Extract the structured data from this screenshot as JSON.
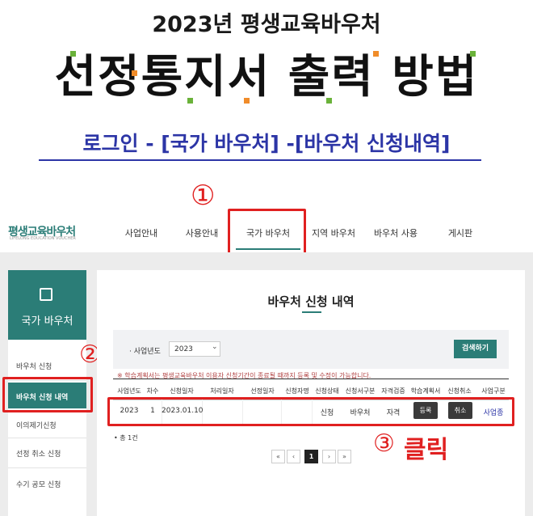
{
  "header": {
    "supertitle": "2023년 평생교육바우처",
    "title": "선정통지서 출력 방법",
    "subtitle": "로그인 - [국가 바우처] -[바우처 신청내역]"
  },
  "annotations": {
    "step1": "①",
    "step2": "②",
    "step3": "③",
    "step3_label": "클릭",
    "color": "#e02020"
  },
  "site": {
    "logo_text": "평생교육바우처",
    "logo_subtext": "LIFELONG EDUCATION VOUCHER"
  },
  "nav": {
    "items": [
      "사업안내",
      "사용안내",
      "국가 바우처",
      "지역 바우처",
      "바우처 사용",
      "게시판"
    ],
    "active": "국가 바우처"
  },
  "sidebar": {
    "title": "국가 바우처",
    "icon": "edit-icon",
    "items": [
      "바우처 신청",
      "바우처 신청 내역",
      "이의제기신청",
      "선정 취소 신청",
      "수기 공모 신청"
    ],
    "active": "바우처 신청 내역"
  },
  "main": {
    "heading": "바우처 신청 내역",
    "filter": {
      "label": "사업년도",
      "value": "2023",
      "search_label": "검색하기"
    },
    "notice": "※ 학습계획서는 평생교육바우처 이용자 신청기간이 종료될 때까지 등록 및 수정이 가능합니다.",
    "table": {
      "columns": [
        "사업년도",
        "차수",
        "신청일자",
        "처리일자",
        "선정일자",
        "신청자명",
        "신청상태",
        "신청서구분",
        "자격검증",
        "학습계획서",
        "신청취소",
        "사업구분"
      ],
      "row": {
        "year": "2023",
        "round": "1",
        "apply_date": "2023.01.10",
        "process_date": "",
        "select_date": "",
        "applicant": "",
        "status": "신청",
        "form_type": "바우처",
        "verification": "자격",
        "plan_button": "등록",
        "cancel_button": "취소",
        "business_type": "사업종"
      }
    },
    "total": "• 총 1건",
    "pagination": [
      "«",
      "‹",
      "1",
      "›",
      "»"
    ],
    "current_page": "1"
  },
  "colors": {
    "accent": "#2b7d77",
    "title_blue": "#2c35a6"
  }
}
